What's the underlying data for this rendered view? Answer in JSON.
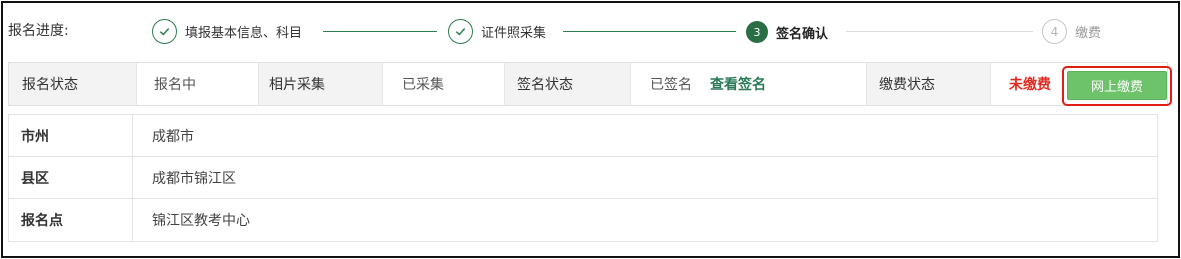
{
  "progress": {
    "label": "报名进度:",
    "steps": [
      {
        "label": "填报基本信息、科目",
        "state": "done",
        "marker": "check"
      },
      {
        "label": "证件照采集",
        "state": "done",
        "marker": "check"
      },
      {
        "label": "签名确认",
        "state": "active",
        "marker": "3"
      },
      {
        "label": "缴费",
        "state": "todo",
        "marker": "4"
      }
    ]
  },
  "status": {
    "enroll_label": "报名状态",
    "enroll_value": "报名中",
    "photo_label": "相片采集",
    "photo_value": "已采集",
    "sign_label": "签名状态",
    "sign_value": "已签名",
    "view_sign_link": "查看签名",
    "pay_label": "缴费状态",
    "pay_value": "未缴费",
    "pay_button": "网上缴费"
  },
  "info": {
    "rows": [
      {
        "label": "市州",
        "value": "成都市"
      },
      {
        "label": "县区",
        "value": "成都市锦江区"
      },
      {
        "label": "报名点",
        "value": "锦江区教考中心"
      }
    ]
  },
  "colors": {
    "accent_green": "#2a6e45",
    "pay_button": "#6cc36a",
    "unpaid_red": "#e02b22",
    "highlight_red": "#e01e12"
  }
}
